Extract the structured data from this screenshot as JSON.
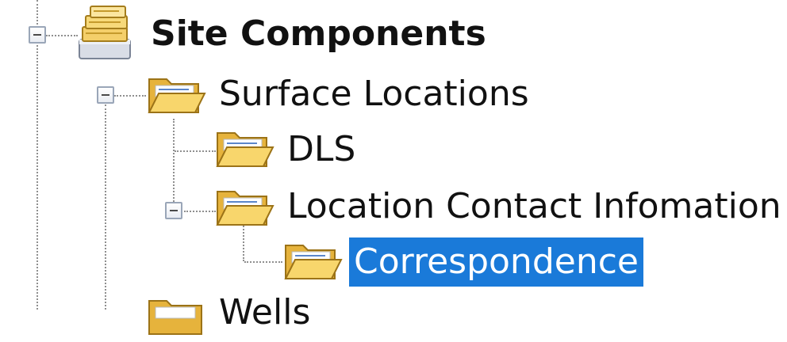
{
  "tree": {
    "site_components": {
      "label": "Site Components",
      "icon": "database-stack-icon",
      "expanded": true
    },
    "surface_locations": {
      "label": "Surface Locations",
      "icon": "open-folder-icon",
      "expanded": true
    },
    "dls": {
      "label": "DLS",
      "icon": "open-folder-icon"
    },
    "location_contact_information": {
      "label": "Location Contact Infomation",
      "icon": "open-folder-icon",
      "expanded": true
    },
    "correspondence": {
      "label": "Correspondence",
      "icon": "open-folder-icon",
      "selected": true
    },
    "wells": {
      "label": "Wells",
      "icon": "folder-icon"
    }
  },
  "colors": {
    "selection_background": "#1a7ad9",
    "selection_text": "#ffffff",
    "folder_yellow": "#f3c44b",
    "connector": "#8f8f8f"
  }
}
